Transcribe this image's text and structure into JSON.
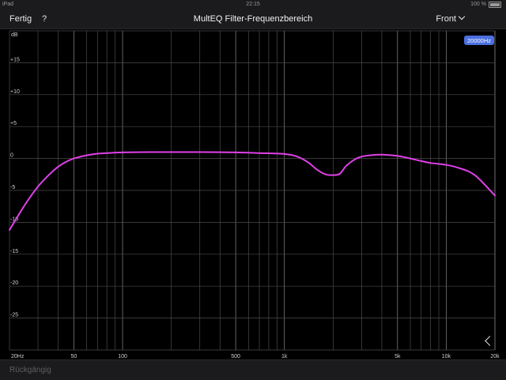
{
  "status_bar": {
    "carrier": "iPad",
    "time": "22:15",
    "battery": "100 %"
  },
  "toolbar": {
    "done_label": "Fertig",
    "help_label": "?",
    "title": "MultEQ Filter-Frequenzbereich",
    "channel_label": "Front",
    "channel_icon": "chevron-down-icon"
  },
  "chart_data": {
    "type": "line",
    "ylabel": "dB",
    "ylim": [
      -30,
      20
    ],
    "xscale": "log",
    "xlim": [
      20,
      20000
    ],
    "x_ticks": [
      {
        "value": 20,
        "label": "20Hz"
      },
      {
        "value": 50,
        "label": "50"
      },
      {
        "value": 100,
        "label": "100"
      },
      {
        "value": 500,
        "label": "500"
      },
      {
        "value": 1000,
        "label": "1k"
      },
      {
        "value": 5000,
        "label": "5k"
      },
      {
        "value": 10000,
        "label": "10k"
      },
      {
        "value": 20000,
        "label": "20k"
      }
    ],
    "y_ticks": [
      {
        "value": 15,
        "label": "+15"
      },
      {
        "value": 10,
        "label": "+10"
      },
      {
        "value": 5,
        "label": "+5"
      },
      {
        "value": 0,
        "label": "0"
      },
      {
        "value": -5,
        "label": "-5"
      },
      {
        "value": -10,
        "label": "-10"
      },
      {
        "value": -15,
        "label": "-15"
      },
      {
        "value": -20,
        "label": "-20"
      },
      {
        "value": -25,
        "label": "-25"
      }
    ],
    "grid": true,
    "marker_label": "20000Hz",
    "series": [
      {
        "color": "#e040e8",
        "x": [
          20,
          25,
          30,
          35,
          40,
          45,
          50,
          60,
          70,
          80,
          100,
          150,
          200,
          300,
          500,
          700,
          1000,
          1200,
          1400,
          1600,
          1800,
          2000,
          2200,
          2400,
          2700,
          3000,
          3500,
          4000,
          5000,
          6000,
          7000,
          8000,
          10000,
          12000,
          15000,
          20000
        ],
        "y": [
          -11.2,
          -7.2,
          -4.4,
          -2.6,
          -1.3,
          -0.5,
          0.0,
          0.5,
          0.75,
          0.85,
          0.95,
          1.0,
          1.0,
          1.0,
          0.95,
          0.85,
          0.7,
          0.3,
          -0.6,
          -1.8,
          -2.5,
          -2.6,
          -2.4,
          -1.2,
          -0.2,
          0.3,
          0.55,
          0.6,
          0.4,
          0.0,
          -0.4,
          -0.7,
          -1.0,
          -1.5,
          -2.6,
          -5.8
        ]
      }
    ]
  },
  "bottom_bar": {
    "undo_label": "Rückgängig"
  },
  "back_icon": "chevron-left-icon"
}
